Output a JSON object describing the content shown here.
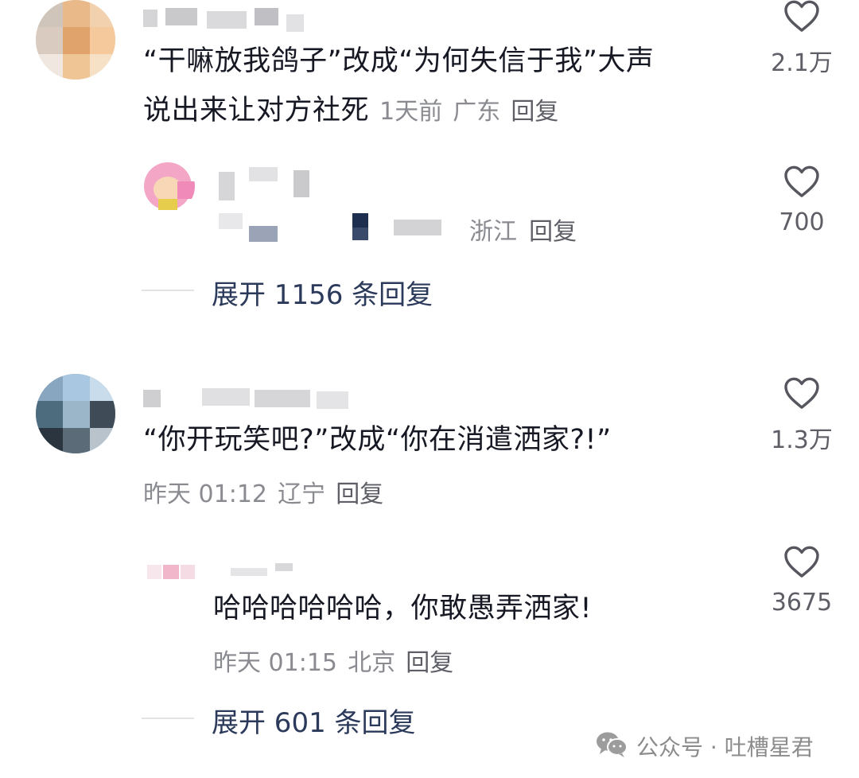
{
  "comments": [
    {
      "text_line1": "“干嘛放我鸽子”改成“为何失信于我”大声",
      "text_line2": "说出来让对方社死",
      "time": "1天前",
      "location": "广东",
      "reply_label": "回复",
      "like_count": "2.1万",
      "sub_reply": {
        "location": "浙江",
        "reply_label": "回复",
        "like_count": "700"
      },
      "expand_label": "展开 1156 条回复"
    },
    {
      "text_line1": "“你开玩笑吧?”改成“你在消遣洒家?!”",
      "time": "昨天 01:12",
      "location": "辽宁",
      "reply_label": "回复",
      "like_count": "1.3万",
      "sub_reply": {
        "text": "哈哈哈哈哈哈，你敢愚弄洒家!",
        "time": "昨天 01:15",
        "location": "北京",
        "reply_label": "回复",
        "like_count": "3675"
      },
      "expand_label": "展开 601 条回复"
    }
  ],
  "watermark": {
    "icon": "wechat-icon",
    "text": "公众号 · 吐槽星君"
  },
  "colors": {
    "text": "#161823",
    "meta": "#8a8b91",
    "expand": "#2b3a5a",
    "line": "#e3e3e6"
  }
}
